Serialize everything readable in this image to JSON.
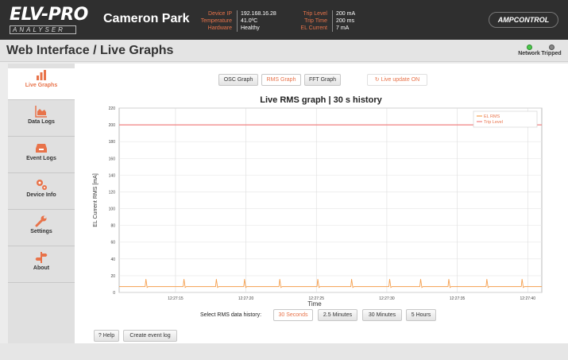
{
  "header": {
    "logo_text": "ELV-PRO",
    "logo_sub": "ANALYSER",
    "site_name": "Cameron Park",
    "status_left": [
      {
        "key": "Device IP",
        "value": "192.168.16.28"
      },
      {
        "key": "Temperature",
        "value": "41.0ºC"
      },
      {
        "key": "Hardware",
        "value": "Healthy"
      }
    ],
    "status_right": [
      {
        "key": "Trip Level",
        "value": "200 mA"
      },
      {
        "key": "Trip Time",
        "value": "200 ms"
      },
      {
        "key": "EL Current",
        "value": "7 mA"
      }
    ],
    "brand": "AMPCONTROL"
  },
  "titlebar": {
    "title": "Web Interface / Live Graphs",
    "indicators": [
      {
        "label": "Network",
        "state": "ok"
      },
      {
        "label": "Tripped",
        "state": "off"
      }
    ]
  },
  "sidebar": {
    "items": [
      {
        "label": "Live Graphs",
        "icon": "bar-chart-icon",
        "active": true
      },
      {
        "label": "Data Logs",
        "icon": "area-chart-icon",
        "active": false
      },
      {
        "label": "Event Logs",
        "icon": "inbox-icon",
        "active": false
      },
      {
        "label": "Device Info",
        "icon": "cogs-icon",
        "active": false
      },
      {
        "label": "Settings",
        "icon": "wrench-icon",
        "active": false
      },
      {
        "label": "About",
        "icon": "signpost-icon",
        "active": false
      }
    ]
  },
  "graph_tabs": [
    {
      "label": "OSC Graph",
      "selected": false
    },
    {
      "label": "RMS Graph",
      "selected": true
    },
    {
      "label": "FFT Graph",
      "selected": false
    }
  ],
  "live_update": {
    "label": "Live update ON",
    "icon": "refresh-icon"
  },
  "history": {
    "label": "Select RMS data history:",
    "options": [
      {
        "label": "30 Seconds",
        "selected": true
      },
      {
        "label": "2.5 Minutes",
        "selected": false
      },
      {
        "label": "30 Minutes",
        "selected": false
      },
      {
        "label": "5 Hours",
        "selected": false
      }
    ]
  },
  "actions": {
    "help": "? Help",
    "create_event": "Create event log"
  },
  "colors": {
    "accent": "#e8734a",
    "trip_line": "#f08080",
    "rms_line": "#f5a050"
  },
  "chart_data": {
    "type": "line",
    "title": "Live RMS graph | 30 s history",
    "xlabel": "Time",
    "ylabel": "EL Current RMS [mA]",
    "ylim": [
      0,
      220
    ],
    "yticks": [
      0,
      20,
      40,
      60,
      80,
      100,
      120,
      140,
      160,
      180,
      200,
      220
    ],
    "xlim": [
      "12:27:11",
      "12:27:41"
    ],
    "xticks": [
      "12:27:15",
      "12:27:20",
      "12:27:25",
      "12:27:30",
      "12:27:35",
      "12:27:40"
    ],
    "grid": true,
    "legend": "top-right",
    "series": [
      {
        "name": "EL RMS",
        "color": "#f5a050",
        "baseline": 7,
        "spike_times": [
          "12:27:12.9",
          "12:27:15.6",
          "12:27:17.9",
          "12:27:19.9",
          "12:27:22.4",
          "12:27:25.1",
          "12:27:27.5",
          "12:27:30.2",
          "12:27:32.4",
          "12:27:34.4",
          "12:27:37.1",
          "12:27:39.6"
        ],
        "spike_peak": 16
      },
      {
        "name": "Trip Level",
        "color": "#f08080",
        "value": 200
      }
    ]
  }
}
